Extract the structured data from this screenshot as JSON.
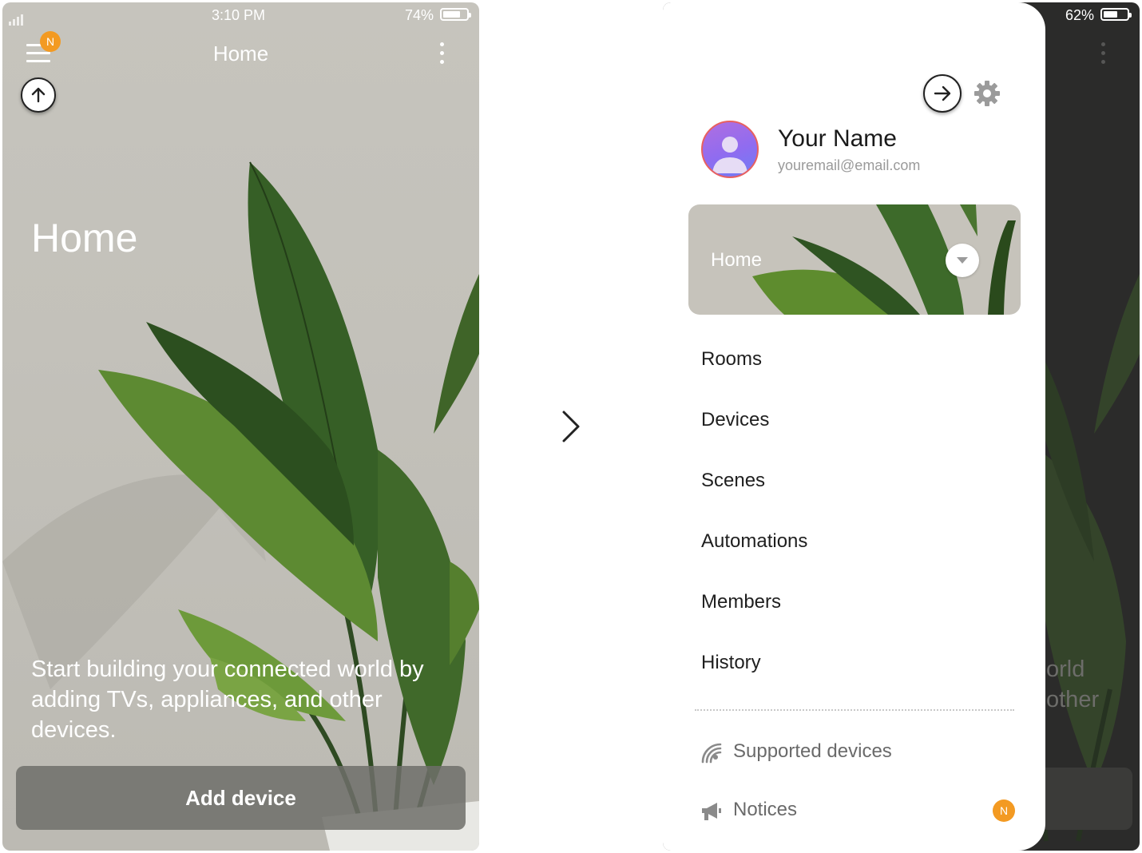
{
  "left_screen": {
    "status_bar": {
      "time": "3:10 PM",
      "battery": "74%",
      "battery_level": 0.74
    },
    "header": {
      "title": "Home",
      "menu_badge": "N"
    },
    "hero_title": "Home",
    "tagline": "Start building your connected world by adding TVs, appliances, and other devices.",
    "add_device_label": "Add device",
    "icons": [
      "menu-icon",
      "more-icon",
      "arrow-up-icon"
    ]
  },
  "transition_icon": "chevron-right-icon",
  "right_screen": {
    "status_bar": {
      "battery": "62%",
      "battery_level": 0.62
    },
    "profile": {
      "name": "Your Name",
      "email": "youremail@email.com"
    },
    "home_selector": {
      "label": "Home"
    },
    "menu_items": [
      {
        "label": "Rooms"
      },
      {
        "label": "Devices"
      },
      {
        "label": "Scenes"
      },
      {
        "label": "Automations"
      },
      {
        "label": "Members"
      },
      {
        "label": "History"
      }
    ],
    "secondary_items": [
      {
        "label": "Supported devices",
        "icon": "signal-icon"
      },
      {
        "label": "Notices",
        "icon": "megaphone-icon",
        "badge": "N"
      }
    ],
    "background_text": {
      "line1": "orld",
      "line2": "other"
    }
  },
  "colors": {
    "badge": "#f39a22",
    "leaf_dark": "#2f5a22",
    "leaf_light": "#6f9a3a"
  }
}
